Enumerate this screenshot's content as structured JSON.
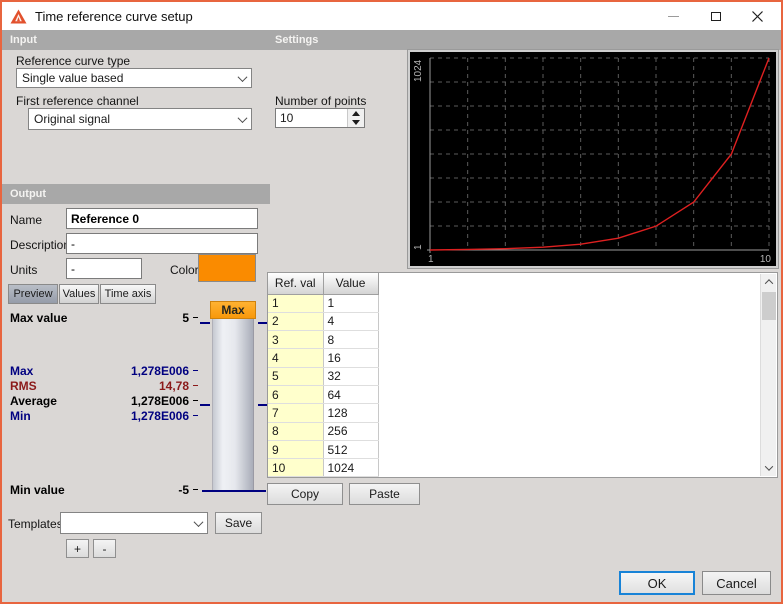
{
  "window": {
    "title": "Time reference curve setup"
  },
  "sections": {
    "input": "Input",
    "settings": "Settings",
    "output": "Output"
  },
  "input": {
    "reference_curve_type": {
      "label": "Reference curve type",
      "value": "Single value based"
    },
    "first_reference_channel": {
      "label": "First reference channel",
      "value": "Original signal"
    }
  },
  "settings": {
    "number_of_points": {
      "label": "Number of points",
      "value": "10"
    }
  },
  "output": {
    "name": {
      "label": "Name",
      "value": "Reference 0"
    },
    "description": {
      "label": "Description",
      "value": "-"
    },
    "units": {
      "label": "Units",
      "value": "-"
    },
    "color": {
      "label": "Color",
      "value": "#fa8b00"
    }
  },
  "tabs": [
    {
      "label": "Preview",
      "selected": true
    },
    {
      "label": "Values",
      "selected": false
    },
    {
      "label": "Time axis",
      "selected": false
    }
  ],
  "preview": {
    "max_value_label": "Max value",
    "max_value": "5",
    "min_value_label": "Min value",
    "min_value": "-5",
    "bar_top_label": "Max",
    "stats": [
      {
        "label": "Max",
        "value": "1,278E006",
        "color": "#000080"
      },
      {
        "label": "RMS",
        "value": "14,78",
        "color": "#8b1a1a"
      },
      {
        "label": "Average",
        "value": "1,278E006",
        "color": "#000000"
      },
      {
        "label": "Min",
        "value": "1,278E006",
        "color": "#000080"
      }
    ]
  },
  "table": {
    "headers": [
      "Ref. val",
      "Value"
    ],
    "rows": [
      [
        "1",
        "1"
      ],
      [
        "2",
        "4"
      ],
      [
        "3",
        "8"
      ],
      [
        "4",
        "16"
      ],
      [
        "5",
        "32"
      ],
      [
        "6",
        "64"
      ],
      [
        "7",
        "128"
      ],
      [
        "8",
        "256"
      ],
      [
        "9",
        "512"
      ],
      [
        "10",
        "1024"
      ]
    ]
  },
  "table_actions": {
    "copy": "Copy",
    "paste": "Paste"
  },
  "templates": {
    "label": "Templates",
    "value": "",
    "save": "Save",
    "add": "+",
    "remove": "-"
  },
  "footer": {
    "ok": "OK",
    "cancel": "Cancel"
  },
  "chart_data": {
    "type": "line",
    "title": "",
    "x": [
      1,
      2,
      3,
      4,
      5,
      6,
      7,
      8,
      9,
      10
    ],
    "values": [
      1,
      4,
      8,
      16,
      32,
      64,
      128,
      256,
      512,
      1024
    ],
    "xlim": [
      1,
      10
    ],
    "ylim": [
      1,
      1024
    ],
    "x_tick_labels": [
      "1",
      "10"
    ],
    "y_tick_labels": [
      "1",
      "1024"
    ],
    "line_color": "#de2020",
    "background": "#000000",
    "grid_color": "#5c5c5c",
    "axis_color": "#9a9a9a",
    "label_color": "#b4b4b4",
    "grid": "dashed",
    "legend": "none"
  }
}
